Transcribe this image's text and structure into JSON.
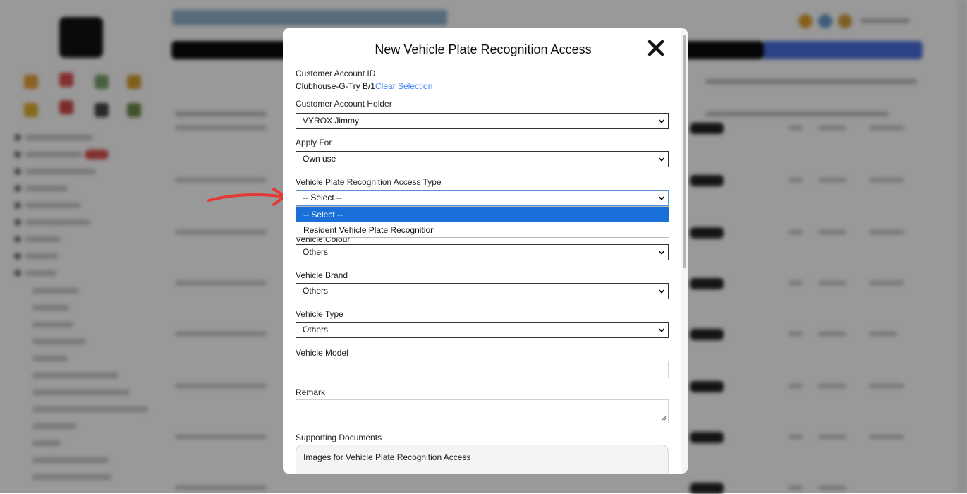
{
  "modal": {
    "title": "New Vehicle Plate Recognition Access",
    "customer_account_id": {
      "label": "Customer Account ID",
      "value": "Clubhouse-G-Try B/1",
      "clear_link": "Clear Selection"
    },
    "customer_account_holder": {
      "label": "Customer Account Holder",
      "value": "VYROX Jimmy"
    },
    "apply_for": {
      "label": "Apply For",
      "value": "Own use"
    },
    "access_type": {
      "label": "Vehicle Plate Recognition Access Type",
      "value": "-- Select --",
      "options": [
        "-- Select --",
        "Resident Vehicle Plate Recognition"
      ]
    },
    "vehicle_colour": {
      "label": "Vehicle Colour",
      "value": "Others"
    },
    "vehicle_brand": {
      "label": "Vehicle Brand",
      "value": "Others"
    },
    "vehicle_type": {
      "label": "Vehicle Type",
      "value": "Others"
    },
    "vehicle_model": {
      "label": "Vehicle Model",
      "value": ""
    },
    "remark": {
      "label": "Remark",
      "value": ""
    },
    "supporting_documents": {
      "label": "Supporting Documents",
      "dropzone_text": "Images for Vehicle Plate Recognition Access"
    }
  },
  "colors": {
    "accent_blue": "#1a6fd8",
    "link_blue": "#3b82f6",
    "annotation_arrow": "#e53935"
  }
}
